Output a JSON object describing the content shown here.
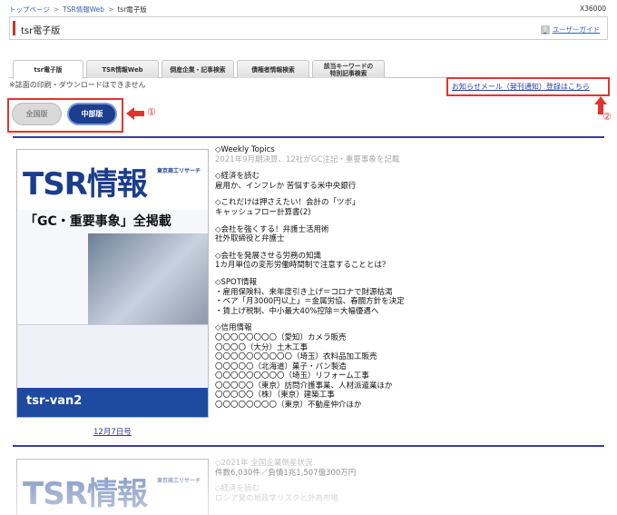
{
  "breadcrumb": {
    "items": [
      "トップページ",
      "TSR情報Web",
      "tsr電子版"
    ]
  },
  "user_id": "X36000",
  "title": "tsr電子版",
  "user_guide": "ユーザーガイド",
  "tabs": [
    {
      "label": "tsr電子版",
      "active": true
    },
    {
      "label": "TSR情報Web",
      "active": false
    },
    {
      "label": "倒産企業・記事検索",
      "active": false
    },
    {
      "label": "債権者情報検索",
      "active": false
    },
    {
      "label": "該当キーワードの\n特別記事検索",
      "active": false
    }
  ],
  "notice": "※誌面の印刷・ダウンロードはできません",
  "mail_link": "お知らせメール（発刊通知）登録はこちら",
  "buttons": {
    "all": "全国版",
    "chubu": "中部版"
  },
  "markers": {
    "one": "①",
    "two": "②"
  },
  "colors": {
    "accent_red": "#e3342f",
    "brand_blue": "#1c3e8f",
    "rule": "#3b3ba0"
  },
  "issue1": {
    "cover": {
      "logo": "TSR情報",
      "publisher": "東京商工リサーチ",
      "headline": "「GC・重要事象」全掲載",
      "banner": "tsr-van2"
    },
    "date_link": "12月7日号",
    "toc": {
      "topics_title": "◇Weekly Topics",
      "topics_sub": "2021年9月期決算、12社がGC注記・重要事象を記載",
      "economy_title": "◇経済を読む",
      "economy_lines": [
        "雇用か、インフレか 苦悩する米中央銀行"
      ],
      "accounting_title": "◇これだけは押さえたい！会計の「ツボ」",
      "accounting_lines": [
        "キャッシュフロー計算書(2)"
      ],
      "lawyer_title": "◇会社を強くする！弁護士活用術",
      "lawyer_lines": [
        "社外取締役と弁護士"
      ],
      "labor_title": "◇会社を発展させる労務の知識",
      "labor_lines": [
        "1カ月単位の変形労働時間制で注意することとは？"
      ],
      "spot_title": "◇SPOT情報",
      "spot_lines": [
        "・雇用保険料、来年度引き上げ＝コロナで財源枯渇",
        "・ベア「月3000円以上」＝金属労協、春闘方針を決定",
        "・賃上げ税制、中小最大40%控除＝大幅優遇へ"
      ],
      "credit_title": "◇信用情報",
      "credit_lines": [
        "〇〇〇〇〇〇〇〇（愛知）カメラ販売",
        "〇〇〇〇（大分）土木工事",
        "〇〇〇〇〇〇〇〇〇〇（埼玉）衣料品加工販売",
        "〇〇〇〇〇（北海道）菓子・パン製造",
        "〇〇〇〇〇〇〇〇〇（埼玉）リフォーム工事",
        "〇〇〇〇〇（東京）訪問介護事業、人材派遣業ほか",
        "〇〇〇〇〇（株）（東京）建築工事",
        "〇〇〇〇〇〇〇〇（東京）不動産仲介ほか"
      ]
    }
  },
  "issue2": {
    "cover": {
      "logo": "TSR情報",
      "publisher": "東京商工リサーチ"
    },
    "toc": {
      "line1": "◇2021年 全国企業倒産状況",
      "line2": "件数6,030件／負債1兆1,507億300万円",
      "line3": "◇経済を読む",
      "line4": "ロシア発の地政学リスクと外為市場"
    }
  }
}
